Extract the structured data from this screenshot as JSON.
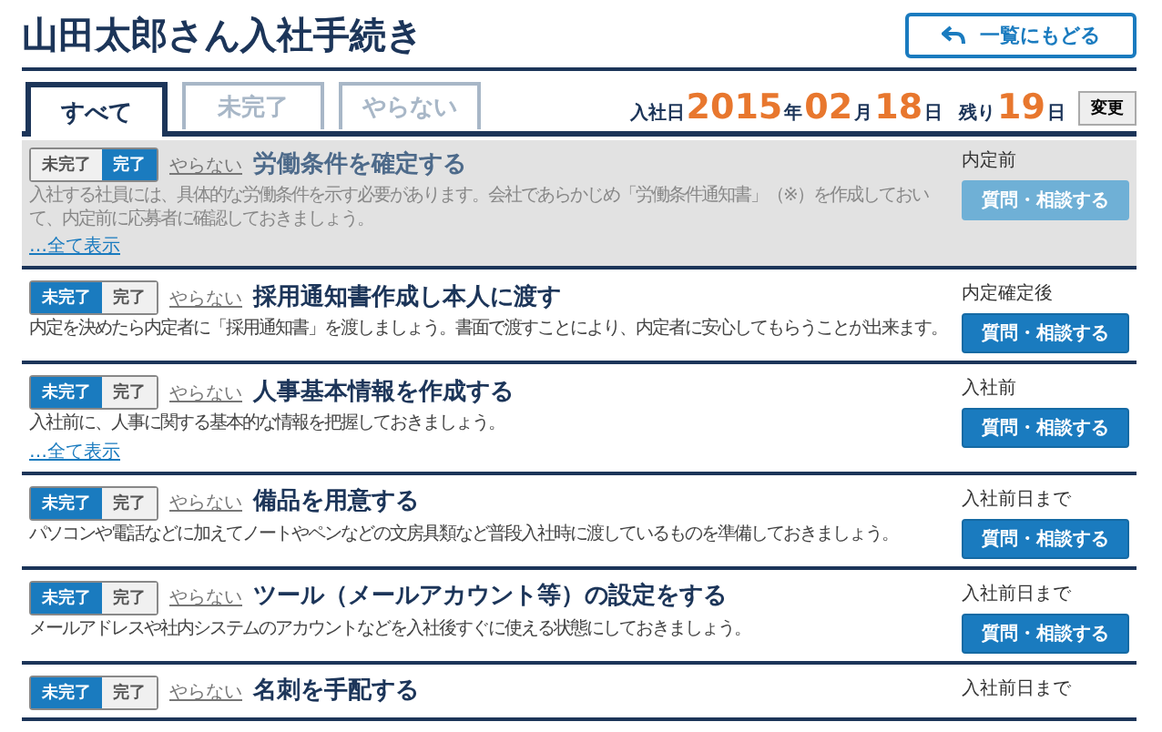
{
  "page_title": "山田太郎さん入社手続き",
  "back_button": {
    "label": "一覧にもどる"
  },
  "tabs": [
    {
      "label": "すべて",
      "selected": true
    },
    {
      "label": "未完了",
      "selected": false
    },
    {
      "label": "やらない",
      "selected": false
    }
  ],
  "join_date": {
    "label": "入社日",
    "year": "2015",
    "year_unit": "年",
    "month": "02",
    "month_unit": "月",
    "day": "18",
    "day_unit": "日",
    "remaining_label": "残り",
    "remaining": "19",
    "remaining_unit": "日",
    "change_button": "変更"
  },
  "tasks": [
    {
      "options": [
        {
          "label": "未完了",
          "selected": false
        },
        {
          "label": "完了",
          "selected": true
        }
      ],
      "skip_link": "やらない",
      "title": "労働条件を確定する",
      "description": "入社する社員には、具体的な労働条件を示す必要があります。会社であらかじめ「労働条件通知書」（※）を作成しておいて、内定前に応募者に確認しておきましょう。",
      "show_all": "…全て表示",
      "timing": "内定前",
      "button": "質問・相談する"
    },
    {
      "options": [
        {
          "label": "未完了",
          "selected": true
        },
        {
          "label": "完了",
          "selected": false
        }
      ],
      "skip_link": "やらない",
      "title": "採用通知書作成し本人に渡す",
      "description": "内定を決めたら内定者に「採用通知書」を渡しましょう。書面で渡すことにより、内定者に安心してもらうことが出来ます。",
      "timing": "内定確定後",
      "button": "質問・相談する"
    },
    {
      "options": [
        {
          "label": "未完了",
          "selected": true
        },
        {
          "label": "完了",
          "selected": false
        }
      ],
      "skip_link": "やらない",
      "title": "人事基本情報を作成する",
      "description": "入社前に、人事に関する基本的な情報を把握しておきましょう。",
      "show_all": "…全て表示",
      "timing": "入社前",
      "button": "質問・相談する"
    },
    {
      "options": [
        {
          "label": "未完了",
          "selected": true
        },
        {
          "label": "完了",
          "selected": false
        }
      ],
      "skip_link": "やらない",
      "title": "備品を用意する",
      "description": "パソコンや電話などに加えてノートやペンなどの文房具類など普段入社時に渡しているものを準備しておきましょう。",
      "timing": "入社前日まで",
      "button": "質問・相談する"
    },
    {
      "options": [
        {
          "label": "未完了",
          "selected": true
        },
        {
          "label": "完了",
          "selected": false
        }
      ],
      "skip_link": "やらない",
      "title": "ツール（メールアカウント等）の設定をする",
      "description": "メールアドレスや社内システムのアカウントなどを入社後すぐに使える状態にしておきましょう。",
      "timing": "入社前日まで",
      "button": "質問・相談する"
    },
    {
      "options": [
        {
          "label": "未完了",
          "selected": true
        },
        {
          "label": "完了",
          "selected": false
        }
      ],
      "skip_link": "やらない",
      "title": "名刺を手配する",
      "timing": "入社前日まで"
    }
  ]
}
